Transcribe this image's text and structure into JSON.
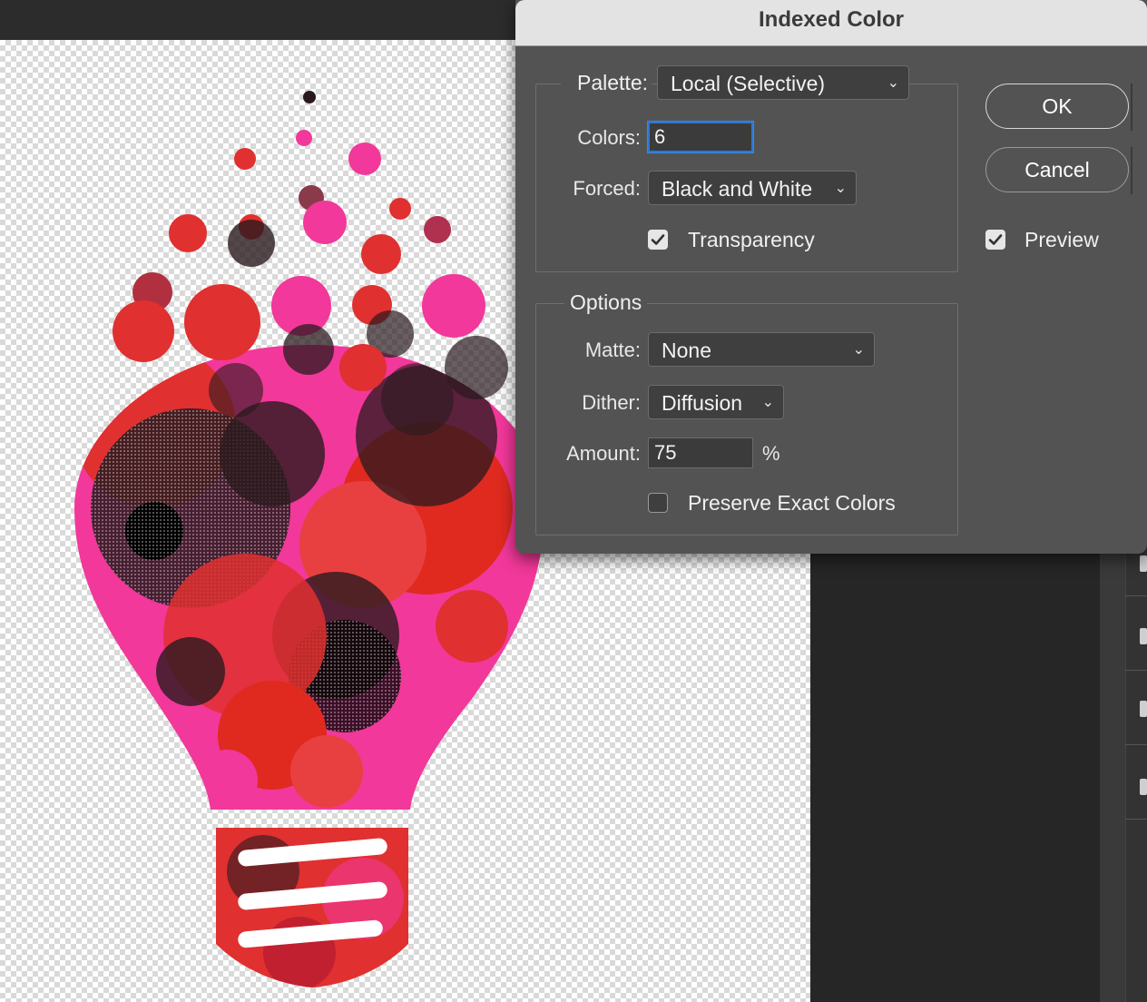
{
  "dialog": {
    "title": "Indexed Color",
    "palette": {
      "label": "Palette:",
      "value": "Local (Selective)"
    },
    "colors": {
      "label": "Colors:",
      "value": "6"
    },
    "forced": {
      "label": "Forced:",
      "value": "Black and White"
    },
    "transparency": {
      "label": "Transparency",
      "checked": true
    },
    "options": {
      "heading": "Options",
      "matte": {
        "label": "Matte:",
        "value": "None"
      },
      "dither": {
        "label": "Dither:",
        "value": "Diffusion"
      },
      "amount": {
        "label": "Amount:",
        "value": "75",
        "unit": "%"
      },
      "preserve_exact_colors": {
        "label": "Preserve Exact Colors",
        "checked": false
      }
    },
    "buttons": {
      "ok": "OK",
      "cancel": "Cancel"
    },
    "preview": {
      "label": "Preview",
      "checked": true
    }
  },
  "colors": {
    "dialog_bg": "#535353",
    "titlebar_bg": "#e3e3e3",
    "focus_ring": "#2a78d4",
    "bulb_red": "#e03030",
    "bulb_pink": "#f2389a",
    "bulb_dark": "#2a1a1e"
  },
  "icons": {
    "dropdown": "chevron-down-icon",
    "checkbox": "checkmark-icon"
  }
}
